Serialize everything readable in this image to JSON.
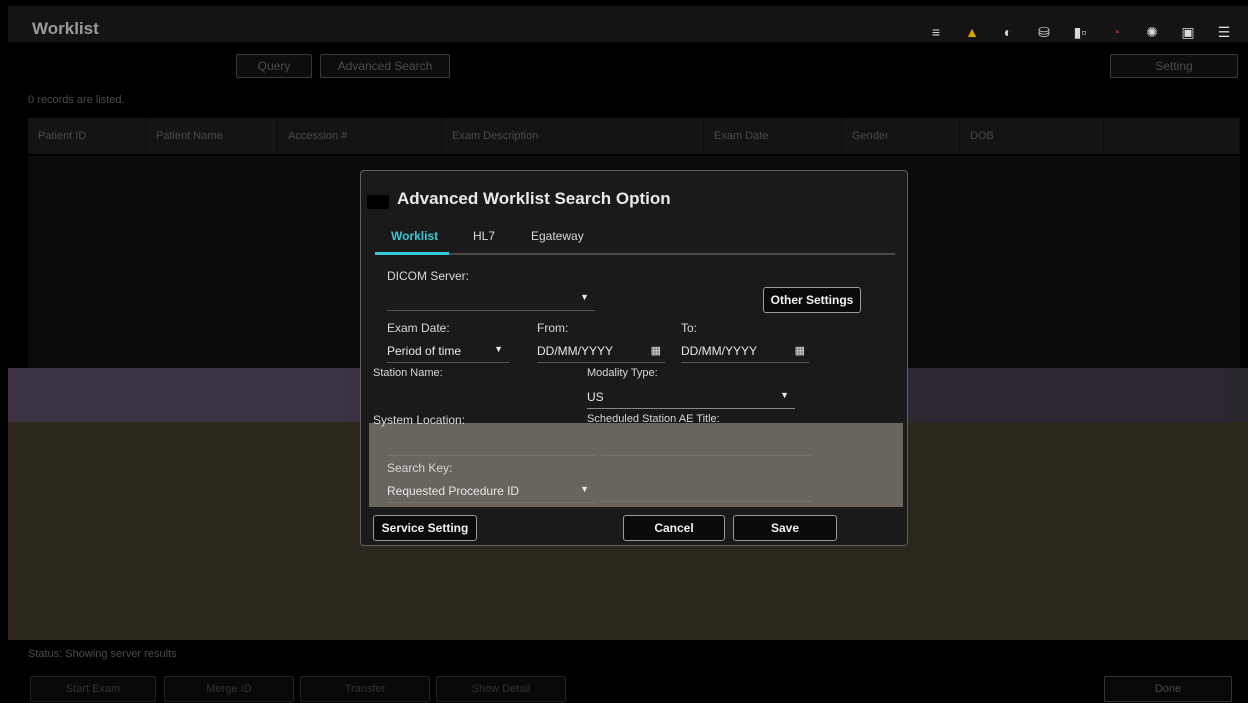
{
  "app": {
    "title": "Worklist"
  },
  "status_icons": [
    {
      "name": "print-queue-icon",
      "glyph": "≡"
    },
    {
      "name": "warning-icon",
      "glyph": "▲"
    },
    {
      "name": "dial-icon",
      "glyph": "◐"
    },
    {
      "name": "usb-icon",
      "glyph": "⛁"
    },
    {
      "name": "network-icon",
      "glyph": "▮▫"
    },
    {
      "name": "wifi-icon",
      "glyph": "◔"
    },
    {
      "name": "globe-icon",
      "glyph": "✺"
    },
    {
      "name": "folder-icon",
      "glyph": "▣"
    },
    {
      "name": "menu-icon",
      "glyph": "☰"
    }
  ],
  "toolbar": {
    "query_label": "Query",
    "advanced_search_label": "Advanced Search",
    "setting_label": "Setting"
  },
  "records_text": "0 records are listed.",
  "table": {
    "headers": [
      "Patient ID",
      "Patient Name",
      "Accession #",
      "Exam Description",
      "Exam Date",
      "Gender",
      "DOB"
    ]
  },
  "status_text": "Status: Showing server results",
  "bottom_buttons": {
    "start_exam": "Start Exam",
    "merge_id": "Merge ID",
    "transfer": "Transfer",
    "show_detail": "Show Detail",
    "done": "Done"
  },
  "dialog": {
    "title": "Advanced Worklist Search Option",
    "tabs": [
      "Worklist",
      "HL7",
      "Egateway"
    ],
    "active_tab": "Worklist",
    "dicom_server_label": "DICOM Server:",
    "dicom_server_value": "",
    "other_settings_label": "Other Settings",
    "exam_date_label": "Exam Date:",
    "exam_date_value": "Period of time",
    "from_label": "From:",
    "from_placeholder": "DD/MM/YYYY",
    "to_label": "To:",
    "to_placeholder": "DD/MM/YYYY",
    "station_name_label": "Station Name:",
    "modality_type_label": "Modality Type:",
    "modality_type_value": "US",
    "system_location_label": "System Location:",
    "scheduled_station_label": "Scheduled Station AE Title:",
    "search_key_label": "Search Key:",
    "search_key_value": "Requested Procedure ID",
    "service_setting_label": "Service Setting",
    "cancel_label": "Cancel",
    "save_label": "Save"
  }
}
